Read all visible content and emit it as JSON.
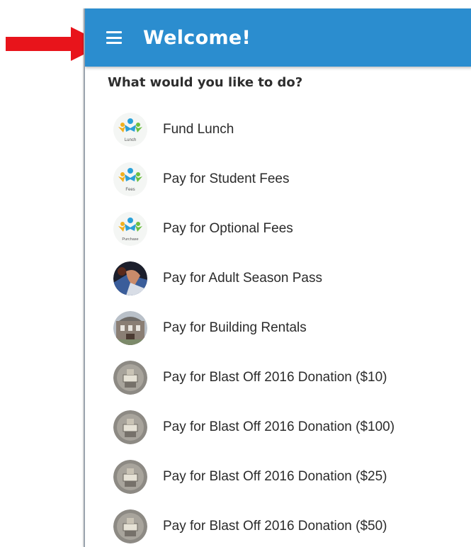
{
  "header": {
    "title": "Welcome!",
    "menu_icon": "hamburger-menu-icon"
  },
  "main": {
    "prompt": "What would you like to do?",
    "items": [
      {
        "label": "Fund Lunch",
        "icon": "lunch-logo-icon",
        "icon_caption": "Lunch"
      },
      {
        "label": "Pay for Student Fees",
        "icon": "fees-logo-icon",
        "icon_caption": "Fees"
      },
      {
        "label": "Pay for Optional Fees",
        "icon": "purchase-logo-icon",
        "icon_caption": "Purchase"
      },
      {
        "label": "Pay for Adult Season Pass",
        "icon": "season-pass-photo-icon"
      },
      {
        "label": "Pay for Building Rentals",
        "icon": "building-photo-icon"
      },
      {
        "label": "Pay for Blast Off 2016 Donation ($10)",
        "icon": "donation-photo-icon"
      },
      {
        "label": "Pay for Blast Off 2016 Donation ($100)",
        "icon": "donation-photo-icon"
      },
      {
        "label": "Pay for Blast Off 2016 Donation ($25)",
        "icon": "donation-photo-icon"
      },
      {
        "label": "Pay for Blast Off 2016 Donation ($50)",
        "icon": "donation-photo-icon"
      }
    ]
  },
  "colors": {
    "appbar": "#2b8dcf",
    "annotation_arrow": "#e8141b"
  }
}
